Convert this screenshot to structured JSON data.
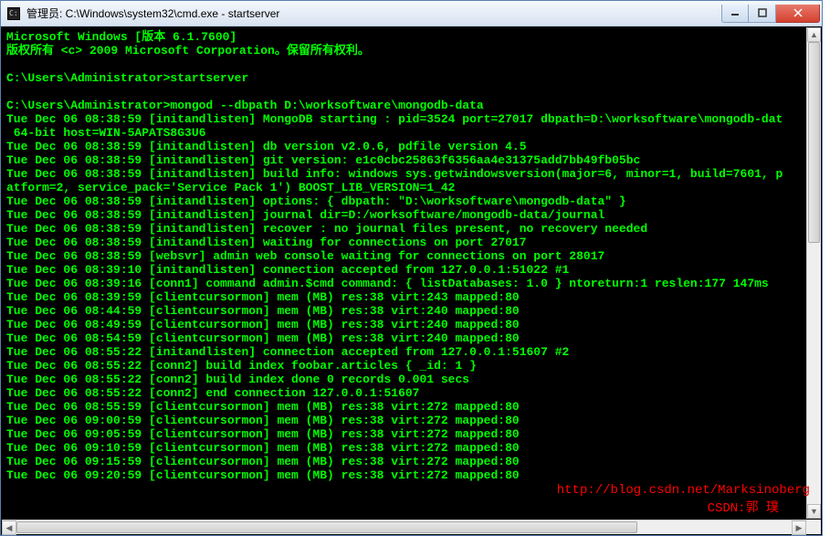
{
  "window": {
    "title": "管理员: C:\\Windows\\system32\\cmd.exe - startserver"
  },
  "terminal": {
    "lines": [
      "Microsoft Windows [版本 6.1.7600]",
      "版权所有 <c> 2009 Microsoft Corporation。保留所有权利。",
      "",
      "C:\\Users\\Administrator>startserver",
      "",
      "C:\\Users\\Administrator>mongod --dbpath D:\\worksoftware\\mongodb-data",
      "Tue Dec 06 08:38:59 [initandlisten] MongoDB starting : pid=3524 port=27017 dbpath=D:\\worksoftware\\mongodb-dat",
      " 64-bit host=WIN-5APATS8G3U6",
      "Tue Dec 06 08:38:59 [initandlisten] db version v2.0.6, pdfile version 4.5",
      "Tue Dec 06 08:38:59 [initandlisten] git version: e1c0cbc25863f6356aa4e31375add7bb49fb05bc",
      "Tue Dec 06 08:38:59 [initandlisten] build info: windows sys.getwindowsversion(major=6, minor=1, build=7601, p",
      "atform=2, service_pack='Service Pack 1') BOOST_LIB_VERSION=1_42",
      "Tue Dec 06 08:38:59 [initandlisten] options: { dbpath: \"D:\\worksoftware\\mongodb-data\" }",
      "Tue Dec 06 08:38:59 [initandlisten] journal dir=D:/worksoftware/mongodb-data/journal",
      "Tue Dec 06 08:38:59 [initandlisten] recover : no journal files present, no recovery needed",
      "Tue Dec 06 08:38:59 [initandlisten] waiting for connections on port 27017",
      "Tue Dec 06 08:38:59 [websvr] admin web console waiting for connections on port 28017",
      "Tue Dec 06 08:39:10 [initandlisten] connection accepted from 127.0.0.1:51022 #1",
      "Tue Dec 06 08:39:16 [conn1] command admin.$cmd command: { listDatabases: 1.0 } ntoreturn:1 reslen:177 147ms",
      "Tue Dec 06 08:39:59 [clientcursormon] mem (MB) res:38 virt:243 mapped:80",
      "Tue Dec 06 08:44:59 [clientcursormon] mem (MB) res:38 virt:240 mapped:80",
      "Tue Dec 06 08:49:59 [clientcursormon] mem (MB) res:38 virt:240 mapped:80",
      "Tue Dec 06 08:54:59 [clientcursormon] mem (MB) res:38 virt:240 mapped:80",
      "Tue Dec 06 08:55:22 [initandlisten] connection accepted from 127.0.0.1:51607 #2",
      "Tue Dec 06 08:55:22 [conn2] build index foobar.articles { _id: 1 }",
      "Tue Dec 06 08:55:22 [conn2] build index done 0 records 0.001 secs",
      "Tue Dec 06 08:55:22 [conn2] end connection 127.0.0.1:51607",
      "Tue Dec 06 08:55:59 [clientcursormon] mem (MB) res:38 virt:272 mapped:80",
      "Tue Dec 06 09:00:59 [clientcursormon] mem (MB) res:38 virt:272 mapped:80",
      "Tue Dec 06 09:05:59 [clientcursormon] mem (MB) res:38 virt:272 mapped:80",
      "Tue Dec 06 09:10:59 [clientcursormon] mem (MB) res:38 virt:272 mapped:80",
      "Tue Dec 06 09:15:59 [clientcursormon] mem (MB) res:38 virt:272 mapped:80",
      "Tue Dec 06 09:20:59 [clientcursormon] mem (MB) res:38 virt:272 mapped:80"
    ]
  },
  "watermark": {
    "url": "http://blog.csdn.net/Marksinoberg",
    "credit": "CSDN:郭 璞"
  }
}
